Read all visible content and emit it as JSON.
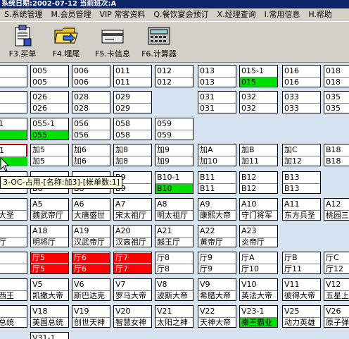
{
  "window": {
    "title": "系统日期:2002-07-12 当前班次:A"
  },
  "menu": [
    "S.系统管理",
    "M.会员管理",
    "VIP 常客资料",
    "Q.餐饮宴会预订",
    "X.经理查询",
    "I.常用信息",
    "H.帮助"
  ],
  "toolbar": [
    {
      "label": "F3.买单",
      "icon": "clipboard-icon"
    },
    {
      "label": "F4.埋尾",
      "icon": "folder-icon"
    },
    {
      "label": "F5.卡信息",
      "icon": "card-icon"
    },
    {
      "label": "F6.计算器",
      "icon": "calculator-icon"
    }
  ],
  "tooltip": "3-OC-占用-[名称:加3]-[帐单数:1]",
  "rows": [
    [
      {
        "a": "3",
        "b": "3"
      },
      {
        "a": "005",
        "b": "005"
      },
      {
        "a": "006",
        "b": "006"
      },
      {
        "a": "011",
        "b": "011"
      },
      {
        "a": "012",
        "b": "012"
      },
      {
        "a": "013",
        "b": "013"
      },
      {
        "a": "015-1",
        "b": "015",
        "g": true
      },
      {
        "a": "016",
        "b": "016"
      },
      {
        "a": "018",
        "b": "018"
      }
    ],
    [
      {
        "a": "5",
        "b": "5"
      },
      {
        "a": "026",
        "b": "026"
      },
      {
        "a": "028",
        "b": "028"
      },
      {
        "a": "029",
        "b": "029"
      },
      null,
      {
        "a": "031",
        "b": "031"
      },
      {
        "a": "032",
        "b": "032"
      },
      {
        "a": "033",
        "b": "033"
      },
      {
        "a": "035",
        "b": "035"
      }
    ],
    [
      {
        "a": "3-1",
        "b": "",
        "g": true
      },
      {
        "a": "055-1",
        "b": "055",
        "g": true
      },
      {
        "a": "056",
        "b": "056"
      },
      {
        "a": "058",
        "b": "058"
      },
      {
        "a": "059",
        "b": "059"
      },
      null,
      null,
      null,
      null
    ],
    [
      {
        "a": "3-1",
        "b": "",
        "g": true,
        "sel": true
      },
      {
        "a": "加5",
        "b": "加5"
      },
      {
        "a": "加6",
        "b": "加6"
      },
      {
        "a": "加8",
        "b": "加8"
      },
      {
        "a": "加9",
        "b": "加9"
      },
      {
        "a": "加A",
        "b": "加10"
      },
      {
        "a": "加B",
        "b": "加11"
      },
      {
        "a": "加C",
        "b": "加12"
      },
      {
        "a": "B18",
        "b": "B18"
      }
    ],
    [
      {
        "a": "",
        "b": "5"
      },
      {
        "a": "",
        "b": "B6"
      },
      {
        "a": "",
        "b": "B8"
      },
      {
        "a": "B9",
        "b": "B9"
      },
      {
        "a": "B10-1",
        "b": "B10",
        "g": true
      },
      {
        "a": "B11",
        "b": "B11"
      },
      {
        "a": "B12",
        "b": "B12"
      },
      {
        "a": "B13",
        "b": "B13"
      },
      null
    ],
    [
      {
        "a": "",
        "b": "天大圣"
      },
      {
        "a": "A5",
        "b": "魏武帝厅"
      },
      {
        "a": "A6",
        "b": "大唐盛世"
      },
      {
        "a": "A7",
        "b": "宋太祖厅"
      },
      {
        "a": "A8",
        "b": "明太祖厅"
      },
      {
        "a": "A9",
        "b": "康熙大帝"
      },
      {
        "a": "A10",
        "b": "守门将军"
      },
      {
        "a": "A11",
        "b": "东方兵圣"
      },
      {
        "a": "A12",
        "b": "桃园三"
      }
    ],
    [
      {
        "a": "7",
        "b": "将厅"
      },
      {
        "a": "A18",
        "b": "明将厅"
      },
      {
        "a": "A19",
        "b": "汉武帝厅"
      },
      {
        "a": "A20",
        "b": "汉高祖厅"
      },
      {
        "a": "A21",
        "b": "越王厅"
      },
      {
        "a": "A22",
        "b": "黄帝厅"
      },
      {
        "a": "A23",
        "b": "炎帝厅"
      },
      null,
      null
    ],
    [
      {
        "a": "3",
        "b": "3"
      },
      {
        "a": "厅5",
        "b": "厅5",
        "r": true
      },
      {
        "a": "厅6",
        "b": "厅6",
        "r": true
      },
      {
        "a": "厅7",
        "b": "厅7",
        "r": true
      },
      {
        "a": "厅8",
        "b": "厅8"
      },
      {
        "a": "厅9",
        "b": "厅9"
      },
      {
        "a": "厅A",
        "b": "厅10"
      },
      {
        "a": "厅B",
        "b": "厅11"
      },
      {
        "a": "厅C",
        "b": "厅12"
      }
    ],
    [
      {
        "a": "",
        "b": "兰西王"
      },
      {
        "a": "V5",
        "b": "凯撒大帝"
      },
      {
        "a": "V6",
        "b": "斯巴达克"
      },
      {
        "a": "V7",
        "b": "罗马大帝"
      },
      {
        "a": "V8",
        "b": "波斯大帝"
      },
      {
        "a": "V9",
        "b": "希腊大帝"
      },
      {
        "a": "V10",
        "b": "英法大帝"
      },
      {
        "a": "V11",
        "b": "彼得大帝"
      },
      {
        "a": "V12",
        "b": "五星上"
      }
    ],
    [
      {
        "a": "7",
        "b": "肯总统"
      },
      {
        "a": "V18",
        "b": "美国总统"
      },
      {
        "a": "V19",
        "b": "创世天神"
      },
      {
        "a": "V20",
        "b": "智慧女神"
      },
      {
        "a": "V21",
        "b": "太阳之神"
      },
      {
        "a": "V22",
        "b": "天神大帝"
      },
      {
        "a": "V23-1",
        "b": "秦王霸业",
        "g": true
      },
      {
        "a": "V25",
        "b": "动力英雄"
      },
      {
        "a": "V26",
        "b": "原子弹"
      }
    ],
    [
      null,
      {
        "a": "V31-1",
        "b": ""
      },
      null,
      null,
      null,
      null,
      null,
      null,
      null
    ]
  ]
}
